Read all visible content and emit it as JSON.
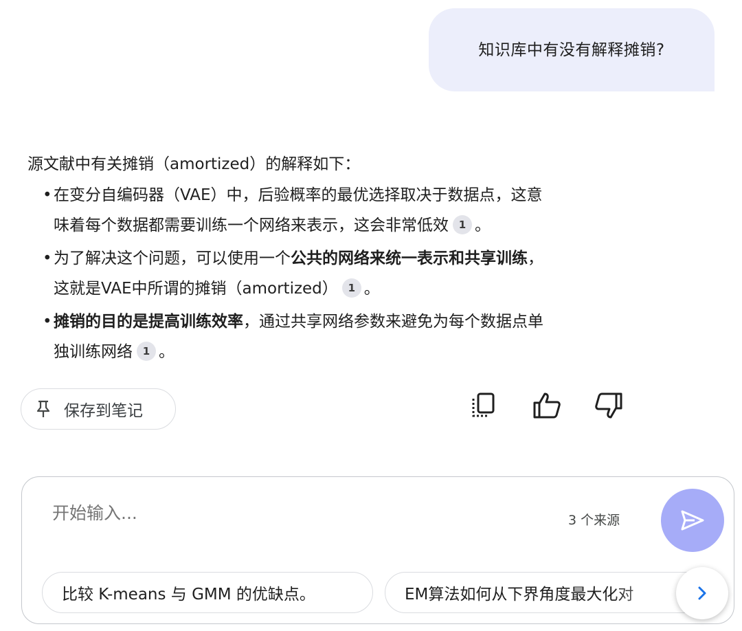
{
  "conversation": {
    "user_message": "知识库中有没有解释摊销?",
    "answer": {
      "intro": "源文献中有关摊销（amortized）的解释如下：",
      "bullets": [
        {
          "line1": "在变分自编码器（VAE）中，后验概率的最优选择取决于数据点，这意",
          "line2": "味着每个数据都需要训练一个网络来表示，这会非常低效",
          "citation": "1",
          "end": "。"
        },
        {
          "prefix": "为了解决这个问题，可以使用一个",
          "bold": "公共的网络来统一表示和共享训练",
          "suffix": "，",
          "line2": "这就是VAE中所谓的摊销（amortized）",
          "citation": "1",
          "end": "。"
        },
        {
          "bold": "摊销的目的是提高训练效率",
          "suffix": "，通过共享网络参数来避免为每个数据点单",
          "line2": "独训练网络",
          "citation": "1",
          "end": "。"
        }
      ]
    }
  },
  "actions": {
    "save_to_note_label": "保存到笔记",
    "icons": [
      "copy-icon",
      "thumbs-up-icon",
      "thumbs-down-icon"
    ]
  },
  "composer": {
    "placeholder": "开始输入...",
    "source_count": "3 个来源",
    "send_icon": "send-icon",
    "suggestions": [
      "比较 K-means 与 GMM 的优缺点。",
      "EM算法如何从下界角度最大化对"
    ],
    "next_icon": "chevron-right-icon"
  },
  "colors": {
    "user_bubble": "#eceefb",
    "send_button": "#a6acf8",
    "citation_chip": "#e3e4ea",
    "next_chevron": "#1a73e8"
  }
}
